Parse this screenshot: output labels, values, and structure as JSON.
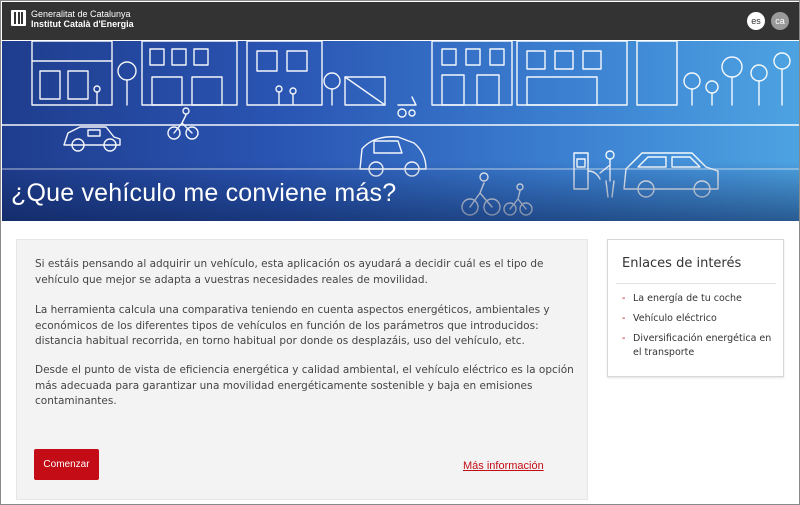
{
  "header": {
    "logo_line1": "Generalitat de Catalunya",
    "logo_line2": "Institut Català d'Energia",
    "languages": [
      {
        "code": "es",
        "active": true
      },
      {
        "code": "ca",
        "active": false
      }
    ]
  },
  "banner": {
    "title": "¿Que vehículo me conviene más?"
  },
  "main": {
    "paragraph1": "Si estáis pensando al adquirir un vehículo, esta aplicación os ayudará a decidir cuál es el tipo de vehículo que mejor se adapta a vuestras necesidades reales de movilidad.",
    "paragraph2": "La herramienta calcula una comparativa teniendo en cuenta aspectos energéticos, ambientales y económicos de los diferentes tipos de vehículos en función de los parámetros que introducidos: distancia habitual recorrida, en torno habitual por donde os desplazáis, uso del vehículo, etc.",
    "paragraph3": "Desde el punto de vista de eficiencia energética y calidad ambiental, el vehículo eléctrico es la opción más adecuada para garantizar una movilidad energéticamente sostenible y baja en emisiones contaminantes.",
    "start_button": "Comenzar",
    "more_info_link": "Más información"
  },
  "sidebar": {
    "title": "Enlaces de interés",
    "links": [
      {
        "label": "La energía de tu coche"
      },
      {
        "label": "Vehículo eléctrico"
      },
      {
        "label": "Diversificación energética en el transporte"
      }
    ]
  },
  "colors": {
    "topbar": "#333333",
    "accent_red": "#c40c16",
    "banner_dark": "#1f3d8e",
    "banner_light": "#4da3e2"
  }
}
